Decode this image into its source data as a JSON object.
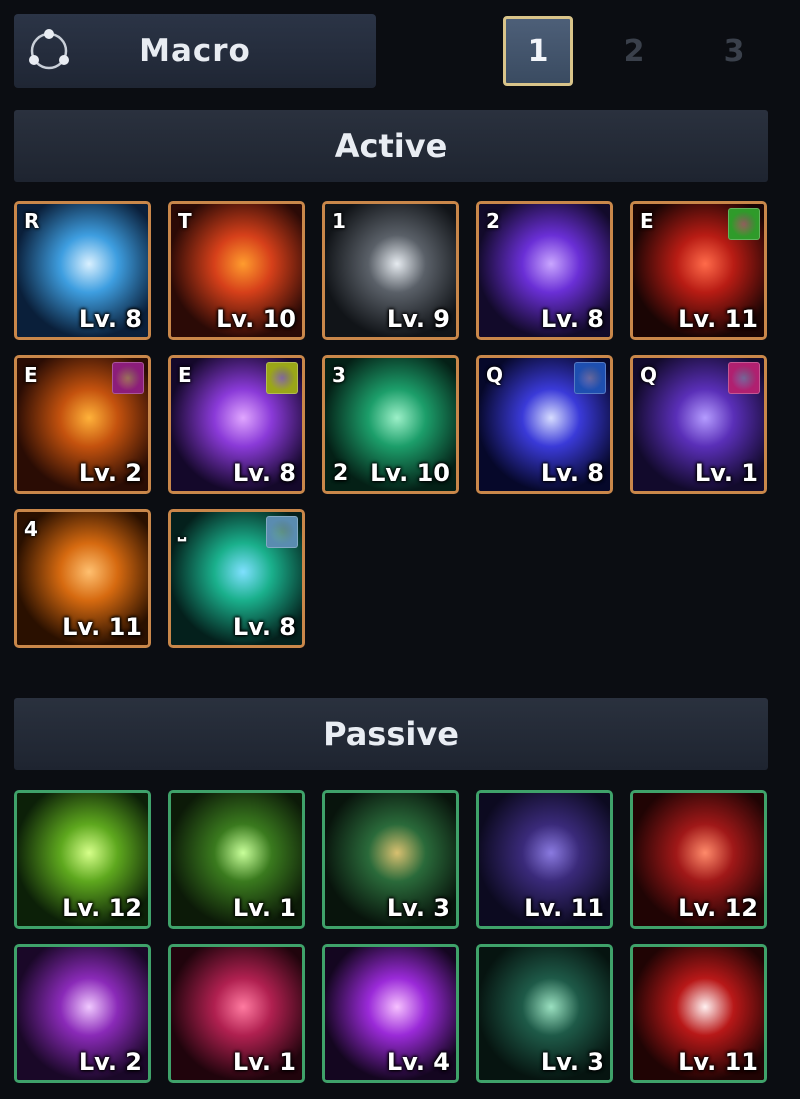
{
  "macro": {
    "label": "Macro",
    "icon": "macro-circle-icon"
  },
  "pages": [
    "1",
    "2",
    "3"
  ],
  "sections": {
    "active": "Active",
    "passive": "Passive"
  },
  "active_skills": [
    {
      "key": "R",
      "level": "Lv. 8",
      "icon": "ice-dragon-skill-icon",
      "colors": [
        "#0a1f3a",
        "#3e9ee0",
        "#d9f0ff"
      ]
    },
    {
      "key": "T",
      "level": "Lv. 10",
      "icon": "fire-vortex-skill-icon",
      "colors": [
        "#2b0a06",
        "#d6401a",
        "#ff9c2e"
      ]
    },
    {
      "key": "1",
      "level": "Lv. 9",
      "icon": "piercing-light-skill-icon",
      "colors": [
        "#111418",
        "#5a6068",
        "#e6ebf0"
      ]
    },
    {
      "key": "2",
      "level": "Lv. 8",
      "icon": "dark-orb-skill-icon",
      "colors": [
        "#120a2a",
        "#6a2fd6",
        "#c9a6ff"
      ]
    },
    {
      "key": "E",
      "level": "Lv. 11",
      "icon": "flame-spikes-skill-icon",
      "colors": [
        "#1a0504",
        "#b81c14",
        "#ff6b4a"
      ],
      "badge": "#2f9b2a"
    },
    {
      "key": "E",
      "level": "Lv. 2",
      "icon": "flame-blades-skill-icon",
      "colors": [
        "#2a0c04",
        "#c4520e",
        "#ffb23a"
      ],
      "badge": "#8c1d7a"
    },
    {
      "key": "E",
      "level": "Lv. 8",
      "icon": "violet-pillars-skill-icon",
      "colors": [
        "#14082a",
        "#8a3ad8",
        "#e0a6ff"
      ],
      "badge": "#9aa618"
    },
    {
      "key": "3",
      "level": "Lv. 10",
      "count": "2",
      "icon": "healing-hand-skill-icon",
      "colors": [
        "#042016",
        "#1c9e6a",
        "#9cf0c8"
      ]
    },
    {
      "key": "Q",
      "level": "Lv. 8",
      "icon": "light-beam-skill-icon",
      "colors": [
        "#06082a",
        "#3a3ad8",
        "#d6dcff"
      ],
      "badge": "#1e4fb0"
    },
    {
      "key": "Q",
      "level": "Lv. 1",
      "icon": "shadow-claw-skill-icon",
      "colors": [
        "#120a2c",
        "#5a2fb8",
        "#b49cff"
      ],
      "badge": "#b02070"
    },
    {
      "key": "4",
      "level": "Lv. 11",
      "icon": "sun-ring-skill-icon",
      "colors": [
        "#2a1000",
        "#d66a10",
        "#ffc070"
      ]
    },
    {
      "key": "⎵",
      "level": "Lv. 8",
      "icon": "emerald-sphere-skill-icon",
      "colors": [
        "#04201c",
        "#1ab08c",
        "#7fe0ff"
      ],
      "badge": "#5a8cb0"
    }
  ],
  "passive_skills": [
    {
      "level": "Lv. 12",
      "icon": "green-wings-passive-icon",
      "colors": [
        "#0c2008",
        "#5ea81e",
        "#d6ff8a"
      ]
    },
    {
      "level": "Lv. 1",
      "icon": "ranger-passive-icon",
      "colors": [
        "#0c1a08",
        "#3a7a1e",
        "#c8ff9a"
      ]
    },
    {
      "level": "Lv. 3",
      "icon": "green-aura-passive-icon",
      "colors": [
        "#08140c",
        "#2a6a3a",
        "#d8c070"
      ]
    },
    {
      "level": "Lv. 11",
      "icon": "hooded-skull-passive-icon",
      "colors": [
        "#0c0a20",
        "#3a2a7a",
        "#8a7ae0"
      ]
    },
    {
      "level": "Lv. 12",
      "icon": "crimson-flex-passive-icon",
      "colors": [
        "#200404",
        "#a01818",
        "#ff8a6a"
      ]
    },
    {
      "level": "Lv. 2",
      "icon": "violet-bear-passive-icon",
      "colors": [
        "#1a0828",
        "#8a2ab8",
        "#f0c8ff"
      ]
    },
    {
      "level": "Lv. 1",
      "icon": "bear-roar-passive-icon",
      "colors": [
        "#20040c",
        "#b02050",
        "#ff7aa0"
      ]
    },
    {
      "level": "Lv. 4",
      "icon": "magenta-arrow-passive-icon",
      "colors": [
        "#140620",
        "#9a2ad8",
        "#f6c0ff"
      ]
    },
    {
      "level": "Lv. 3",
      "icon": "knight-guard-passive-icon",
      "colors": [
        "#061410",
        "#1e5a48",
        "#9ae0c0"
      ]
    },
    {
      "level": "Lv. 11",
      "icon": "white-swirl-passive-icon",
      "colors": [
        "#200404",
        "#b81818",
        "#fff0f0"
      ]
    }
  ]
}
